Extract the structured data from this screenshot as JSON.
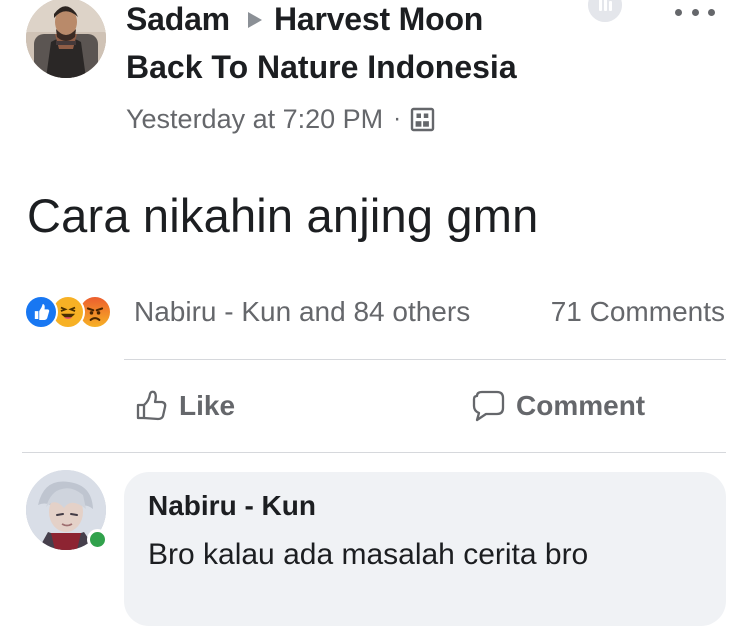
{
  "post": {
    "author": "Sadam",
    "group_name": "Harvest Moon Back To Nature Indonesia",
    "group_line_one": "Harvest Moon",
    "group_line_two": "Back To Nature Indonesia",
    "timestamp": "Yesterday at 7:20 PM",
    "meta_separator": "·",
    "body_text": "Cara nikahin anjing gmn",
    "reaction_summary": "Nabiru - Kun and 84 others",
    "comment_count": "71 Comments"
  },
  "actions": {
    "like_label": "Like",
    "comment_label": "Comment"
  },
  "comment": {
    "author": "Nabiru - Kun",
    "text": "Bro kalau ada masalah cerita bro"
  },
  "icons": {
    "author_avatar": "person-photo-avatar",
    "group_arrow": "triangle-right-icon",
    "privacy": "members-only-icon",
    "more": "more-options-icon",
    "reaction_like": "like-reaction-icon",
    "reaction_haha": "haha-reaction-icon",
    "reaction_angry": "angry-reaction-icon",
    "like_action": "thumbs-up-icon",
    "comment_action": "speech-bubble-icon",
    "commenter_avatar": "anime-character-avatar",
    "online": "online-status-dot"
  },
  "colors": {
    "text_primary": "#1c1e21",
    "text_secondary": "#65676b",
    "comment_bubble": "#f0f2f5",
    "divider": "#d6d8dc",
    "like_blue": "#1877f2",
    "reaction_yellow": "#f7b125",
    "reaction_orange": "#ec5e2f",
    "online_green": "#31a24c"
  }
}
